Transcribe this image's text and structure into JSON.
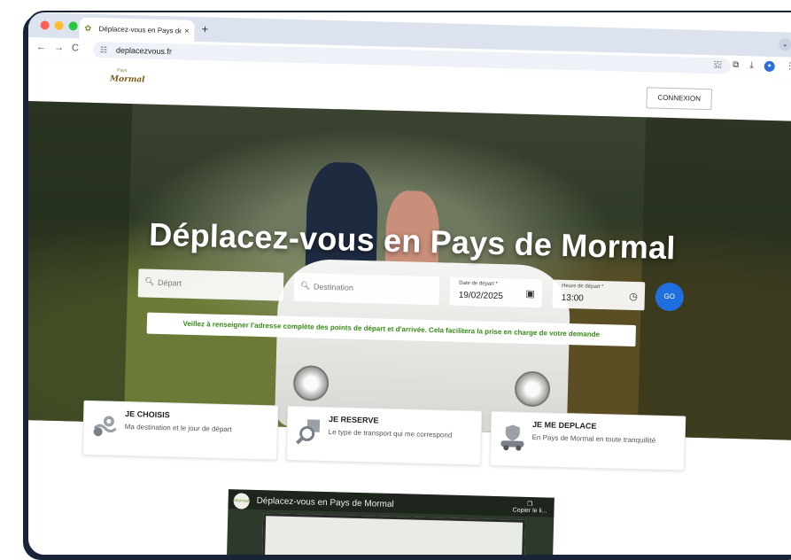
{
  "browser": {
    "tab_title": "Déplacez-vous en Pays de M",
    "tab_close": "×",
    "new_tab": "+",
    "tab_menu": "⌄",
    "url": "deplacezvous.fr",
    "back": "←",
    "forward": "→",
    "reload": "C",
    "url_icon": "☷",
    "star": "☆",
    "extensions_icon": "⬚",
    "tab_search_icon": "⧉",
    "download_icon": "⤓",
    "menu_icon": "⋮",
    "avatar": "●"
  },
  "header": {
    "logo_small": "Pays",
    "logo_text": "Mormal",
    "connexion_label": "CONNEXION"
  },
  "hero": {
    "title": "Déplacez-vous en Pays de Mormal",
    "search": {
      "depart_placeholder": "Départ",
      "destination_placeholder": "Destination",
      "date_label": "Date de départ *",
      "date_value": "19/02/2025",
      "time_label": "Heure de départ *",
      "time_value": "13:00",
      "go_label": "GO"
    },
    "notice": "Veillez à renseigner l'adresse complète des points de départ et d'arrivée. Cela facilitera la prise en charge de votre demande"
  },
  "steps": [
    {
      "title": "JE CHOISIS",
      "desc": "Ma destination et le jour de départ",
      "icon": "map-pin-icon"
    },
    {
      "title": "JE RESERVE",
      "desc": "Le type de transport qui me correspond",
      "icon": "magnifier-icon"
    },
    {
      "title": "JE ME DEPLACE",
      "desc": "En Pays de Mormal en toute tranquillité",
      "icon": "car-shield-icon"
    }
  ],
  "video": {
    "title": "Déplacez-vous en Pays de Mormal",
    "copy_label": "Copier le li...",
    "logo": "Mormal"
  },
  "colors": {
    "accent": "#1f6fe0",
    "notice_green": "#3a8a1a",
    "frame": "#1a2438"
  }
}
